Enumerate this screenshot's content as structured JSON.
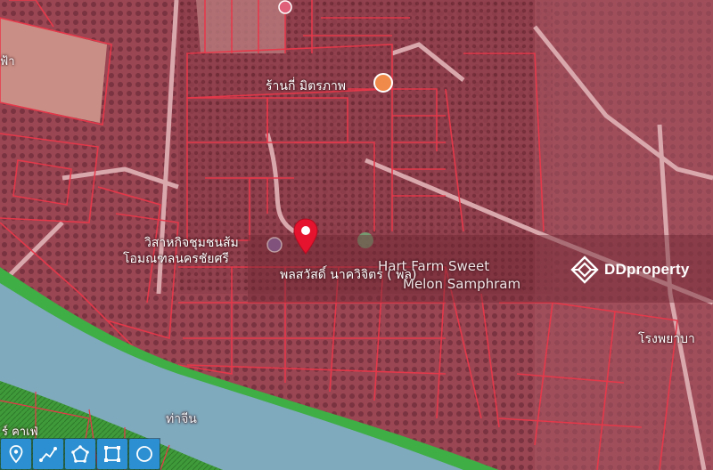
{
  "map": {
    "labels": {
      "shop": "ร้านกี่ มิตรภาพ",
      "community_1": "วิสาหกิจชุมชนส้ม",
      "community_2": "โอมณฑลนครชัยศรี",
      "farm_1": "Hart Farm Sweet",
      "farm_2": "Melon Samphram",
      "pin_label": "พลสวัสดิ์ นาควิจิตร ( พล)",
      "river": "ท่าจีน",
      "hospital": "โรงพยาบา",
      "left_edge": "ฟ้า",
      "bottom_left": "ร์ คาเฟ่"
    },
    "river_color": "#7fa9bd",
    "parcel_line_color": "#e8384a",
    "land_tint": "#a24a57",
    "pin_color": "#e5132d"
  },
  "brand": {
    "name": "DDproperty",
    "icon": "ddproperty-logo"
  },
  "toolbar": {
    "tools": [
      {
        "name": "pin-tool-icon"
      },
      {
        "name": "measure-tool-icon"
      },
      {
        "name": "polygon-tool-icon"
      },
      {
        "name": "rectangle-tool-icon"
      },
      {
        "name": "circle-tool-icon"
      }
    ]
  }
}
